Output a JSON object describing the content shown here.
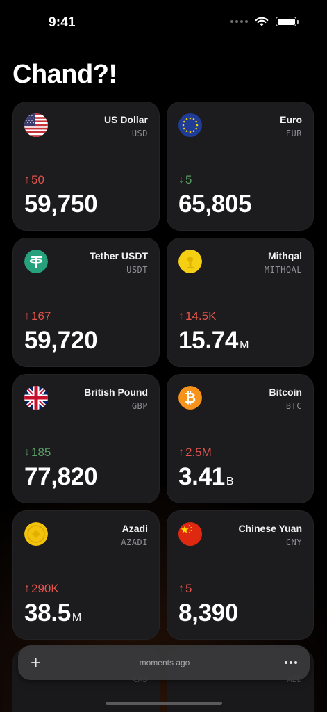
{
  "status": {
    "time": "9:41"
  },
  "app": {
    "title": "Chand?!"
  },
  "cards": [
    {
      "name": "US Dollar",
      "code": "USD",
      "direction": "up",
      "arrow": "↑",
      "change": "50",
      "price": "59,750",
      "unit": "",
      "icon": "us-flag-icon"
    },
    {
      "name": "Euro",
      "code": "EUR",
      "direction": "down",
      "arrow": "↓",
      "change": "5",
      "price": "65,805",
      "unit": "",
      "icon": "eu-flag-icon"
    },
    {
      "name": "Tether USDT",
      "code": "USDT",
      "direction": "up",
      "arrow": "↑",
      "change": "167",
      "price": "59,720",
      "unit": "",
      "icon": "tether-icon"
    },
    {
      "name": "Mithqal",
      "code": "MITHQAL",
      "direction": "up",
      "arrow": "↑",
      "change": "14.5K",
      "price": "15.74",
      "unit": "M",
      "icon": "gold-coin-icon"
    },
    {
      "name": "British Pound",
      "code": "GBP",
      "direction": "down",
      "arrow": "↓",
      "change": "185",
      "price": "77,820",
      "unit": "",
      "icon": "uk-flag-icon"
    },
    {
      "name": "Bitcoin",
      "code": "BTC",
      "direction": "up",
      "arrow": "↑",
      "change": "2.5M",
      "price": "3.41",
      "unit": "B",
      "icon": "bitcoin-icon"
    },
    {
      "name": "Azadi",
      "code": "AZADI",
      "direction": "up",
      "arrow": "↑",
      "change": "290K",
      "price": "38.5",
      "unit": "M",
      "icon": "azadi-coin-icon"
    },
    {
      "name": "Chinese Yuan",
      "code": "CNY",
      "direction": "up",
      "arrow": "↑",
      "change": "5",
      "price": "8,390",
      "unit": "",
      "icon": "china-flag-icon"
    }
  ],
  "peek": [
    {
      "code": "CAD"
    },
    {
      "code": "AED"
    }
  ],
  "toolbar": {
    "add_symbol": "+",
    "updated": "moments ago"
  },
  "colors": {
    "up": "#e2544d",
    "down": "#58a066",
    "card_bg": "#1c1c1e",
    "bar_bg": "#3a3a3c"
  }
}
